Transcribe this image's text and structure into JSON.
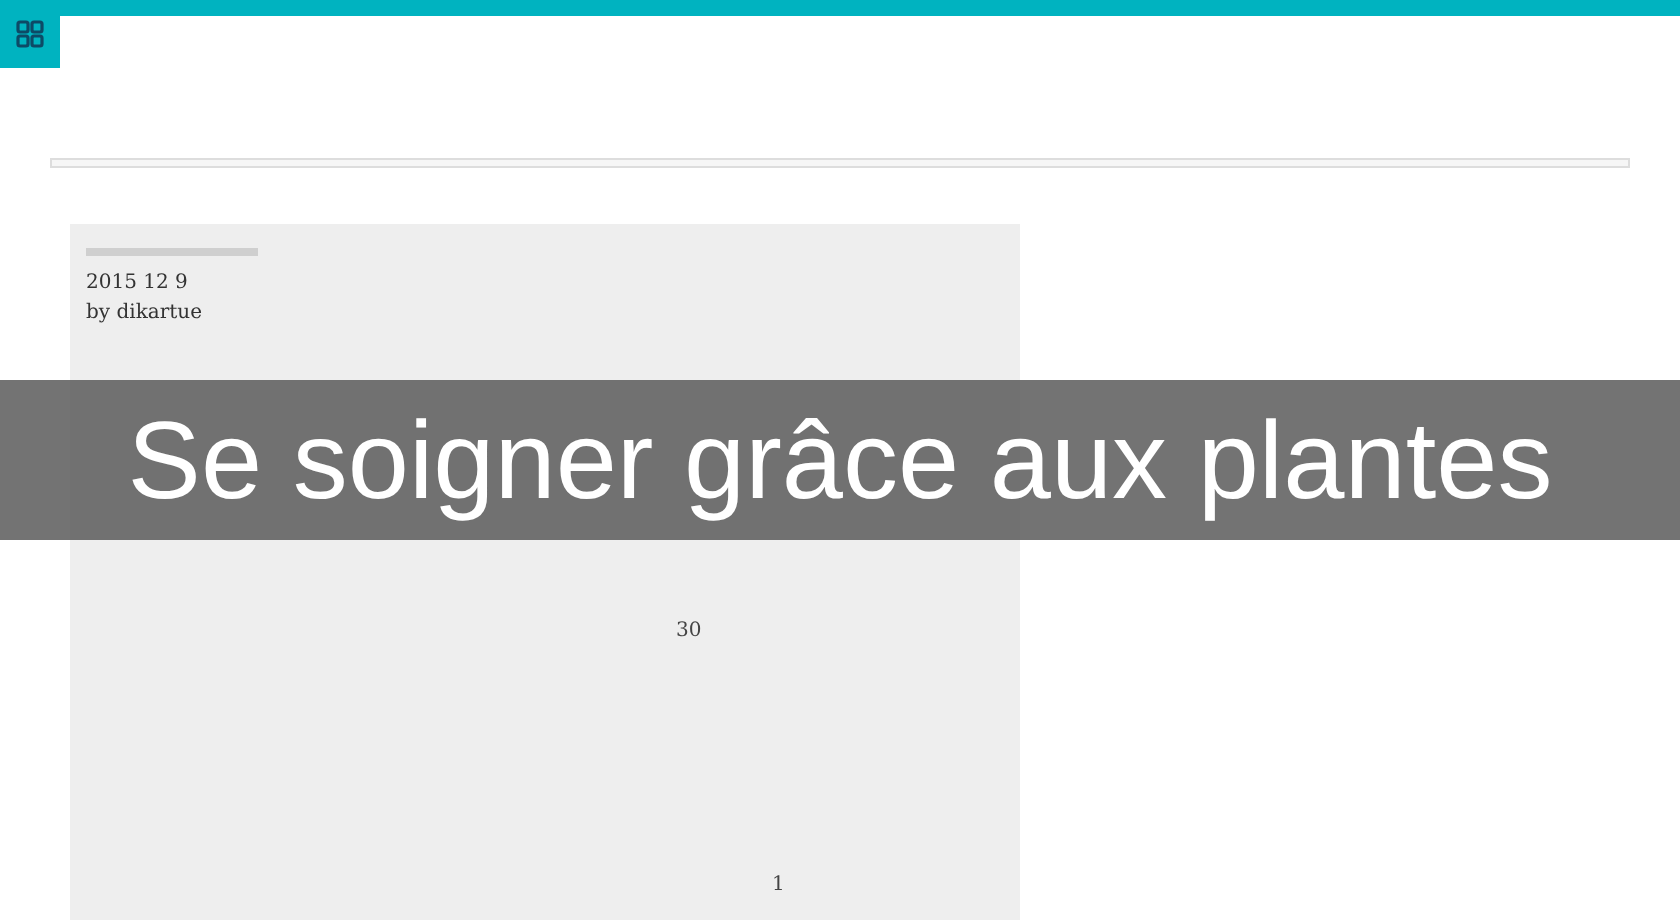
{
  "post": {
    "date": "2015 12 9",
    "author": "by dikartue",
    "count": "30",
    "page": "1"
  },
  "banner": {
    "title": "Se soigner grâce aux plantes"
  }
}
